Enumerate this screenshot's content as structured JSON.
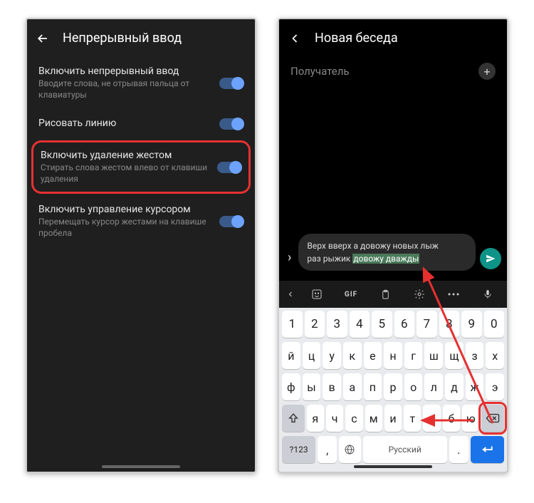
{
  "left": {
    "title": "Непрерывный ввод",
    "items": [
      {
        "title": "Включить непрерывный ввод",
        "desc": "Вводите слова, не отрывая пальца от клавиатуры"
      },
      {
        "title": "Рисовать линию",
        "desc": ""
      },
      {
        "title": "Включить удаление жестом",
        "desc": "Стирать слова жестом влево от клавиши удаления"
      },
      {
        "title": "Включить управление курсором",
        "desc": "Перемещать курсор жестами на клавише пробела"
      }
    ]
  },
  "right": {
    "title": "Новая беседа",
    "recipient": "Получатель",
    "msgLine1": "Верх вверх а довожу новых лыж",
    "msgLine2a": "раз рыжик ",
    "msgLine2b": "довожу дважды",
    "toolbar": {
      "gif": "GIF"
    },
    "rows": {
      "num": [
        "1",
        "2",
        "3",
        "4",
        "5",
        "6",
        "7",
        "8",
        "9",
        "0"
      ],
      "r1": [
        "й",
        "ц",
        "у",
        "к",
        "е",
        "н",
        "г",
        "ш",
        "щ",
        "з",
        "х"
      ],
      "r2": [
        "ф",
        "ы",
        "в",
        "а",
        "п",
        "р",
        "о",
        "л",
        "д",
        "ж",
        "э"
      ],
      "r3": [
        "я",
        "ч",
        "с",
        "м",
        "и",
        "т",
        "ь",
        "б",
        "ю"
      ],
      "sym": "?123",
      "space": "Русский",
      "comma": ",",
      "period": "."
    }
  }
}
